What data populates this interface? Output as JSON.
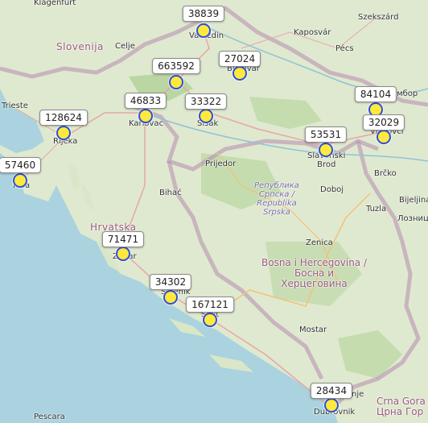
{
  "places": {
    "klagenfurt": "Klagenfurt",
    "szekszard": "Szekszárd",
    "slovenija": "Slovenija",
    "celje": "Celje",
    "varazdin": "Varaždin",
    "kaposvar": "Kaposvár",
    "pecs": "Pécs",
    "bjelovar": "Bjelovar",
    "sombor": "Сомбор",
    "trieste": "Trieste",
    "karlovac": "Karlovac",
    "sisak": "Sisak",
    "rijeka": "Rijeka",
    "prijedor": "Prijedor",
    "slavonski_brod": "Slavonski\nBrod",
    "vinkovci": "Vinkovci",
    "brcko": "Brčko",
    "republika": "Република\nСрпска /\nRepublika\nSrpska",
    "doboj": "Doboj",
    "pula": "Pula",
    "bihac": "Bihać",
    "tuzla": "Tuzla",
    "bijeljina": "Bijeljina",
    "loznica": "Лозница",
    "hrvatska": "Hrvatska",
    "zadar": "Zadar",
    "zenica": "Zenica",
    "bih": "Bosna i Hercegovina /\nБосна и\nХерцеговина",
    "sibenik": "Šibenik",
    "split": "Split",
    "mostar": "Mostar",
    "dubrovnik": "Dubrovnik",
    "pescara": "Pescara",
    "crna_gora": "Crna Gora\nЦрна Гор",
    "sep": "nje"
  },
  "markers": [
    {
      "name": "varazdin",
      "value": "38839"
    },
    {
      "name": "zagreb",
      "value": "663592"
    },
    {
      "name": "bjelovar",
      "value": "27024"
    },
    {
      "name": "karlovac",
      "value": "46833"
    },
    {
      "name": "sisak",
      "value": "33322"
    },
    {
      "name": "osijek",
      "value": "84104"
    },
    {
      "name": "vinkovci",
      "value": "32029"
    },
    {
      "name": "rijeka",
      "value": "128624"
    },
    {
      "name": "slavonski-brod",
      "value": "53531"
    },
    {
      "name": "pula",
      "value": "57460"
    },
    {
      "name": "zadar",
      "value": "71471"
    },
    {
      "name": "sibenik",
      "value": "34302"
    },
    {
      "name": "split",
      "value": "167121"
    },
    {
      "name": "dubrovnik",
      "value": "28434"
    }
  ]
}
